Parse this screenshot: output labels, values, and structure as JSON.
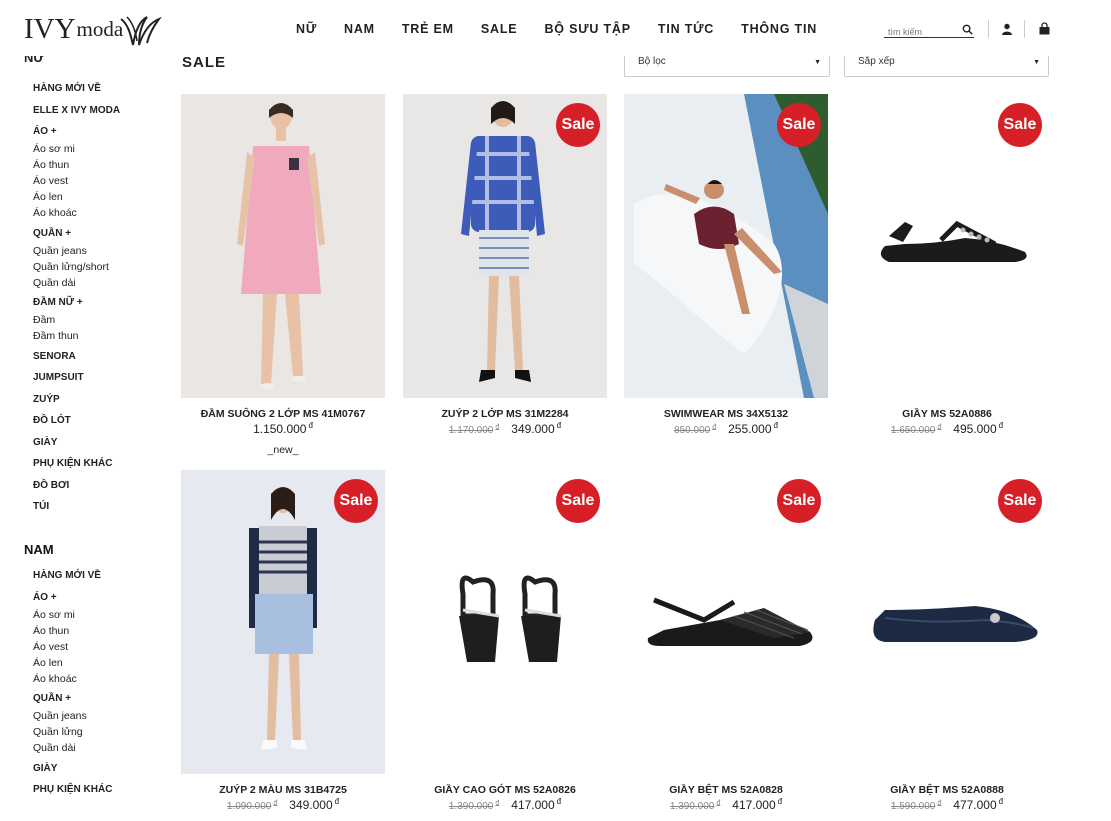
{
  "header": {
    "logo_text": "IVY",
    "logo_sub": "moda",
    "nav": [
      "NỮ",
      "NAM",
      "TRẺ EM",
      "SALE",
      "BỘ SƯU TẬP",
      "TIN TỨC",
      "THÔNG TIN"
    ],
    "search_placeholder": "tìm kiếm"
  },
  "sidebar": {
    "top_cut": "NỮ",
    "nu_items": [
      {
        "label": "HÀNG MỚI VỀ",
        "type": "cat"
      },
      {
        "label": "ELLE X IVY MODA",
        "type": "cat"
      },
      {
        "label": "ÁO +",
        "type": "cat"
      },
      {
        "label": "Áo sơ mi",
        "type": "sub"
      },
      {
        "label": "Áo thun",
        "type": "sub"
      },
      {
        "label": "Áo vest",
        "type": "sub"
      },
      {
        "label": "Áo len",
        "type": "sub"
      },
      {
        "label": "Áo khoác",
        "type": "sub"
      },
      {
        "label": "QUẦN +",
        "type": "cat"
      },
      {
        "label": "Quần jeans",
        "type": "sub"
      },
      {
        "label": "Quần lửng/short",
        "type": "sub"
      },
      {
        "label": "Quần dài",
        "type": "sub"
      },
      {
        "label": "ĐẦM NỮ +",
        "type": "cat"
      },
      {
        "label": "Đầm",
        "type": "sub"
      },
      {
        "label": "Đầm thun",
        "type": "sub"
      },
      {
        "label": "SENORA",
        "type": "cat"
      },
      {
        "label": "JUMPSUIT",
        "type": "cat"
      },
      {
        "label": "ZUÝP",
        "type": "cat"
      },
      {
        "label": "ĐỒ LÓT",
        "type": "cat"
      },
      {
        "label": "GIÀY",
        "type": "cat"
      },
      {
        "label": "PHỤ KIỆN KHÁC",
        "type": "cat"
      },
      {
        "label": "ĐỒ BƠI",
        "type": "cat"
      },
      {
        "label": "TÚI",
        "type": "cat"
      }
    ],
    "nam_title": "NAM",
    "nam_items": [
      {
        "label": "HÀNG MỚI VỀ",
        "type": "cat"
      },
      {
        "label": "ÁO +",
        "type": "cat"
      },
      {
        "label": "Áo sơ mi",
        "type": "sub"
      },
      {
        "label": "Áo thun",
        "type": "sub"
      },
      {
        "label": "Áo vest",
        "type": "sub"
      },
      {
        "label": "Áo len",
        "type": "sub"
      },
      {
        "label": "Áo khoác",
        "type": "sub"
      },
      {
        "label": "QUẦN +",
        "type": "cat"
      },
      {
        "label": "Quần jeans",
        "type": "sub"
      },
      {
        "label": "Quần lửng",
        "type": "sub"
      },
      {
        "label": "Quần dài",
        "type": "sub"
      },
      {
        "label": "GIÀY",
        "type": "cat"
      },
      {
        "label": "PHỤ KIỆN KHÁC",
        "type": "cat"
      }
    ]
  },
  "main": {
    "title": "SALE",
    "filter_label": "Bộ lọc",
    "sort_label": "Sắp xếp"
  },
  "products": [
    {
      "name": "ĐẦM SUÔNG 2 LỚP MS 41M0767",
      "old_price": "",
      "price": "1.150.000",
      "currency": "đ",
      "sale": false,
      "tag": "_new_",
      "image": "pink-dress-photo"
    },
    {
      "name": "ZUÝP 2 LỚP MS 31M2284",
      "old_price": "1.170.000",
      "price": "349.000",
      "currency": "đ",
      "sale": true,
      "tag": "",
      "image": "plaid-jacket-skirt-photo"
    },
    {
      "name": "SWIMWEAR MS 34X5132",
      "old_price": "850.000",
      "price": "255.000",
      "currency": "đ",
      "sale": true,
      "tag": "",
      "image": "swimwear-pool-photo"
    },
    {
      "name": "GIẦY MS 52A0886",
      "old_price": "1.650.000",
      "price": "495.000",
      "currency": "đ",
      "sale": true,
      "tag": "",
      "image": "black-sandal-photo"
    },
    {
      "name": "ZUÝP 2 MÀU MS 31B4725",
      "old_price": "1.090.000",
      "price": "349.000",
      "currency": "đ",
      "sale": true,
      "tag": "",
      "image": "blue-skirt-photo"
    },
    {
      "name": "GIẦY CAO GÓT MS 52A0826",
      "old_price": "1.390.000",
      "price": "417.000",
      "currency": "đ",
      "sale": true,
      "tag": "",
      "image": "platform-heels-photo"
    },
    {
      "name": "GIẦY BỆT MS 52A0828",
      "old_price": "1.390.000",
      "price": "417.000",
      "currency": "đ",
      "sale": true,
      "tag": "",
      "image": "woven-flat-photo"
    },
    {
      "name": "GIẦY BỆT MS 52A0888",
      "old_price": "1.590.000",
      "price": "477.000",
      "currency": "đ",
      "sale": true,
      "tag": "",
      "image": "navy-flat-photo"
    }
  ],
  "sale_badge": "Sale",
  "colors": {
    "sale": "#d61f26",
    "text": "#222222"
  }
}
